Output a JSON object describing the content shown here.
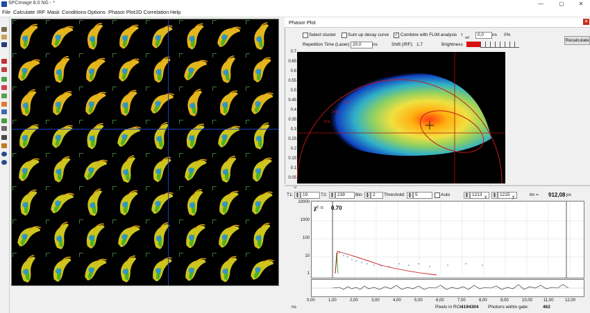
{
  "window": {
    "title": "SPCImage 8.0 NG - *"
  },
  "menu": [
    "File",
    "Calculate",
    "IRF",
    "Mask",
    "Conditions",
    "Options",
    "Phasor Plot",
    "2D Correlation",
    "Help"
  ],
  "phasor": {
    "title": "Phasor Plot",
    "select_cluster": "Select cluster",
    "sum_decay": "Sum up decay curve",
    "combine_flim": "Combine with FLIM analysis",
    "combine_checked": "✓",
    "tref_label": "τ",
    "tref_sub": "ref",
    "tref_value": "0,0",
    "tref_unit": "ns",
    "percent": "0%",
    "rep_time_label": "Repetition Time (Laser) :",
    "rep_time_value": "20,0",
    "rep_time_unit": "ns",
    "shift_label": "Shift (IRF):",
    "shift_value": "1.7",
    "brightness_label": "Brightness",
    "recalc_label": "Recalculate",
    "yticks": [
      "0.7",
      "0.65",
      "0.6",
      "0.55",
      "0.5",
      "0.45",
      "0.4",
      "0.35",
      "0.3",
      "0.25",
      "0.2",
      "0.15",
      "0.1",
      "0.05",
      "0"
    ],
    "curve_labels": [
      "3 ns",
      "2 ns",
      "1 ns"
    ]
  },
  "decay": {
    "t1_label": "T1:",
    "t1_value": "19",
    "t2_label": "T2:",
    "t2_value": "239",
    "bin_label": "Bin:",
    "bin_value": "2",
    "threshold_label": "Threshold:",
    "threshold_value": "5",
    "auto_label": "Auto",
    "x_value": "1213",
    "x_label": "x",
    "y_value": "1215",
    "y_label": "y",
    "tm_label": "tm =",
    "tm_value": "912,08",
    "tm_unit": "ps",
    "chi_label": "χ²  =",
    "chi_value": "0.70",
    "yticks": [
      "10000",
      "1000",
      "100",
      "10",
      "1"
    ],
    "xticks": [
      "0,00",
      "1,00",
      "2,00",
      "3,00",
      "4,00",
      "5,00",
      "6,00",
      "7,00",
      "8,00",
      "9,00",
      "10,00",
      "11,00",
      "12,00"
    ],
    "ns_label": "ns",
    "pixels_label": "Pixels in ROI:",
    "pixels_value": "4194304",
    "photons_label": "Photons within gate:",
    "photons_value": "462"
  },
  "colors": {
    "accent_red": "#c42b1c",
    "cross_line": "#b01010"
  }
}
